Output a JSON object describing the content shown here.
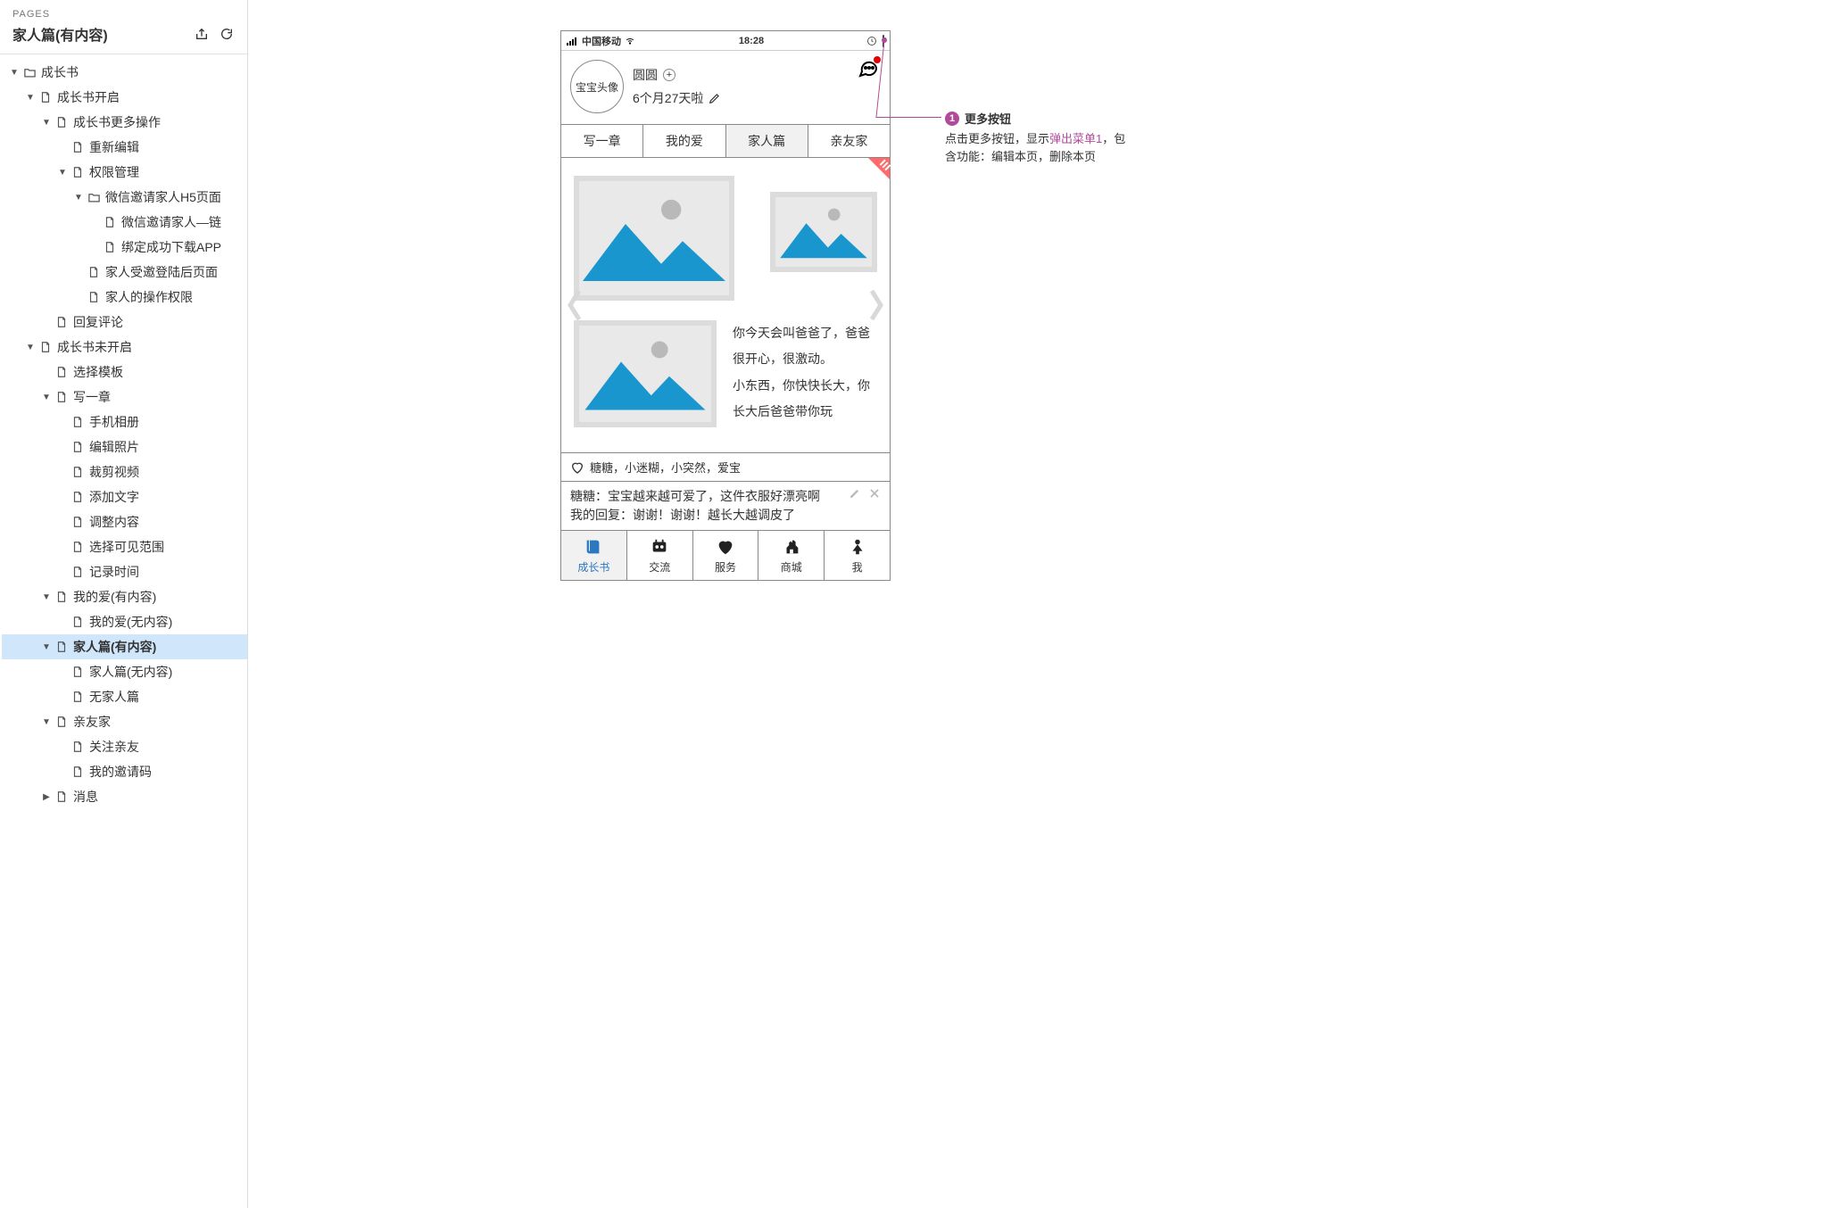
{
  "sidebar": {
    "panel_label": "PAGES",
    "page_title": "家人篇(有内容)",
    "tree": [
      {
        "d": 0,
        "caret": "down",
        "icon": "folder",
        "label": "成长书"
      },
      {
        "d": 1,
        "caret": "down",
        "icon": "page",
        "label": "成长书开启"
      },
      {
        "d": 2,
        "caret": "down",
        "icon": "page",
        "label": "成长书更多操作"
      },
      {
        "d": 3,
        "caret": "none",
        "icon": "page",
        "label": "重新编辑"
      },
      {
        "d": 3,
        "caret": "down",
        "icon": "page",
        "label": "权限管理"
      },
      {
        "d": 4,
        "caret": "down",
        "icon": "folder",
        "label": "微信邀请家人H5页面"
      },
      {
        "d": 5,
        "caret": "none",
        "icon": "page",
        "label": "微信邀请家人—链"
      },
      {
        "d": 5,
        "caret": "none",
        "icon": "page",
        "label": "绑定成功下载APP"
      },
      {
        "d": 4,
        "caret": "none",
        "icon": "page",
        "label": "家人受邀登陆后页面"
      },
      {
        "d": 4,
        "caret": "none",
        "icon": "page",
        "label": "家人的操作权限"
      },
      {
        "d": 2,
        "caret": "none",
        "icon": "page",
        "label": "回复评论"
      },
      {
        "d": 1,
        "caret": "down",
        "icon": "page",
        "label": "成长书未开启"
      },
      {
        "d": 2,
        "caret": "none",
        "icon": "page",
        "label": "选择模板"
      },
      {
        "d": 2,
        "caret": "down",
        "icon": "page",
        "label": "写一章"
      },
      {
        "d": 3,
        "caret": "none",
        "icon": "page",
        "label": "手机相册"
      },
      {
        "d": 3,
        "caret": "none",
        "icon": "page",
        "label": "编辑照片"
      },
      {
        "d": 3,
        "caret": "none",
        "icon": "page",
        "label": "裁剪视频"
      },
      {
        "d": 3,
        "caret": "none",
        "icon": "page",
        "label": "添加文字"
      },
      {
        "d": 3,
        "caret": "none",
        "icon": "page",
        "label": "调整内容"
      },
      {
        "d": 3,
        "caret": "none",
        "icon": "page",
        "label": "选择可见范围"
      },
      {
        "d": 3,
        "caret": "none",
        "icon": "page",
        "label": "记录时间"
      },
      {
        "d": 2,
        "caret": "down",
        "icon": "page",
        "label": "我的爱(有内容)"
      },
      {
        "d": 3,
        "caret": "none",
        "icon": "page",
        "label": "我的爱(无内容)"
      },
      {
        "d": 2,
        "caret": "down",
        "icon": "page",
        "label": "家人篇(有内容)",
        "selected": true,
        "bold": true
      },
      {
        "d": 3,
        "caret": "none",
        "icon": "page",
        "label": "家人篇(无内容)"
      },
      {
        "d": 3,
        "caret": "none",
        "icon": "page",
        "label": "无家人篇"
      },
      {
        "d": 2,
        "caret": "down",
        "icon": "page",
        "label": "亲友家"
      },
      {
        "d": 3,
        "caret": "none",
        "icon": "page",
        "label": "关注亲友"
      },
      {
        "d": 3,
        "caret": "none",
        "icon": "page",
        "label": "我的邀请码"
      },
      {
        "d": 2,
        "caret": "right",
        "icon": "page",
        "label": "消息"
      }
    ]
  },
  "phone": {
    "status": {
      "carrier": "中国移动",
      "time": "18:28"
    },
    "profile": {
      "avatar_text": "宝宝头像",
      "name": "圆圆",
      "age": "6个月27天啦"
    },
    "top_tabs": [
      "写一章",
      "我的爱",
      "家人篇",
      "亲友家"
    ],
    "top_tab_active": 2,
    "content_text": {
      "line1": "你今天会叫爸爸了，爸爸很开心，很激动。",
      "line2": "小东西，你快快长大，你长大后爸爸带你玩"
    },
    "likes_text": "糖糖，小迷糊，小突然，爱宝",
    "comments": {
      "line1": "糖糖：宝宝越来越可爱了，这件衣服好漂亮啊",
      "line2": "我的回复：谢谢！谢谢！越长大越调皮了"
    },
    "bottom_tabs": [
      "成长书",
      "交流",
      "服务",
      "商城",
      "我"
    ],
    "bottom_tab_active": 0
  },
  "callout": {
    "num": "1",
    "title": "更多按钮",
    "body_a": "点击更多按钮，显示",
    "body_link": "弹出菜单1",
    "body_b": "，包含功能：编辑本页，删除本页"
  }
}
